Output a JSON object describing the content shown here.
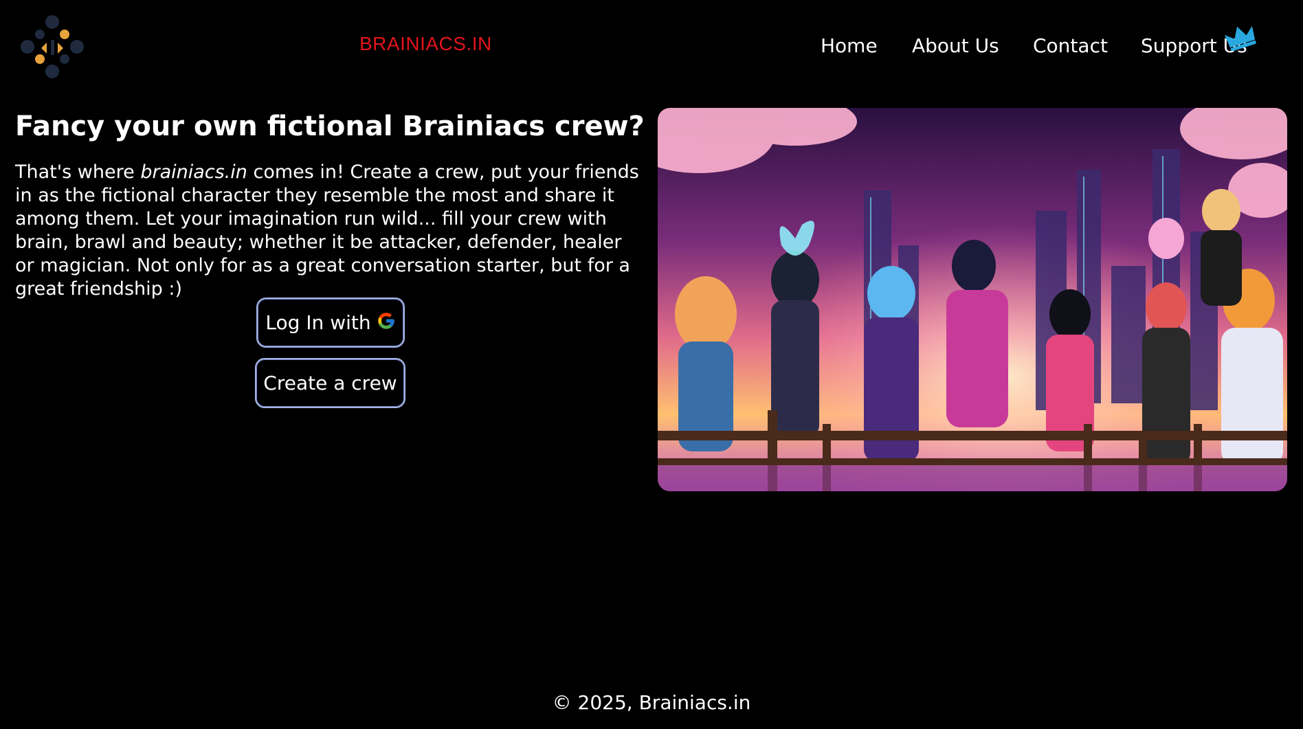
{
  "header": {
    "brand": "BRAINIACS.IN",
    "nav": [
      "Home",
      "About Us",
      "Contact",
      "Support Us"
    ]
  },
  "hero": {
    "title": "Fancy your own fictional Brainiacs crew?",
    "text_before": "That's where ",
    "text_em": "brainiacs.in",
    "text_after": " comes in! Create a crew, put your friends in as the fictional character they resemble the most and share it among them. Let your imagination run wild... fill your crew with brain, brawl and beauty; whether it be attacker, defender, healer or magician. Not only for as a great conversation starter, but for a great friendship :)",
    "login_label": "Log In with",
    "create_label": "Create a crew"
  },
  "footer": {
    "copyright": "© 2025, Brainiacs.in"
  },
  "colors": {
    "brand_red": "#e0151b",
    "crown_blue": "#29a8e0",
    "button_border": "#a7b7e3"
  },
  "icons": {
    "logo": "brainiacs-logo-icon",
    "crown": "crown-icon",
    "google": "google-icon"
  }
}
